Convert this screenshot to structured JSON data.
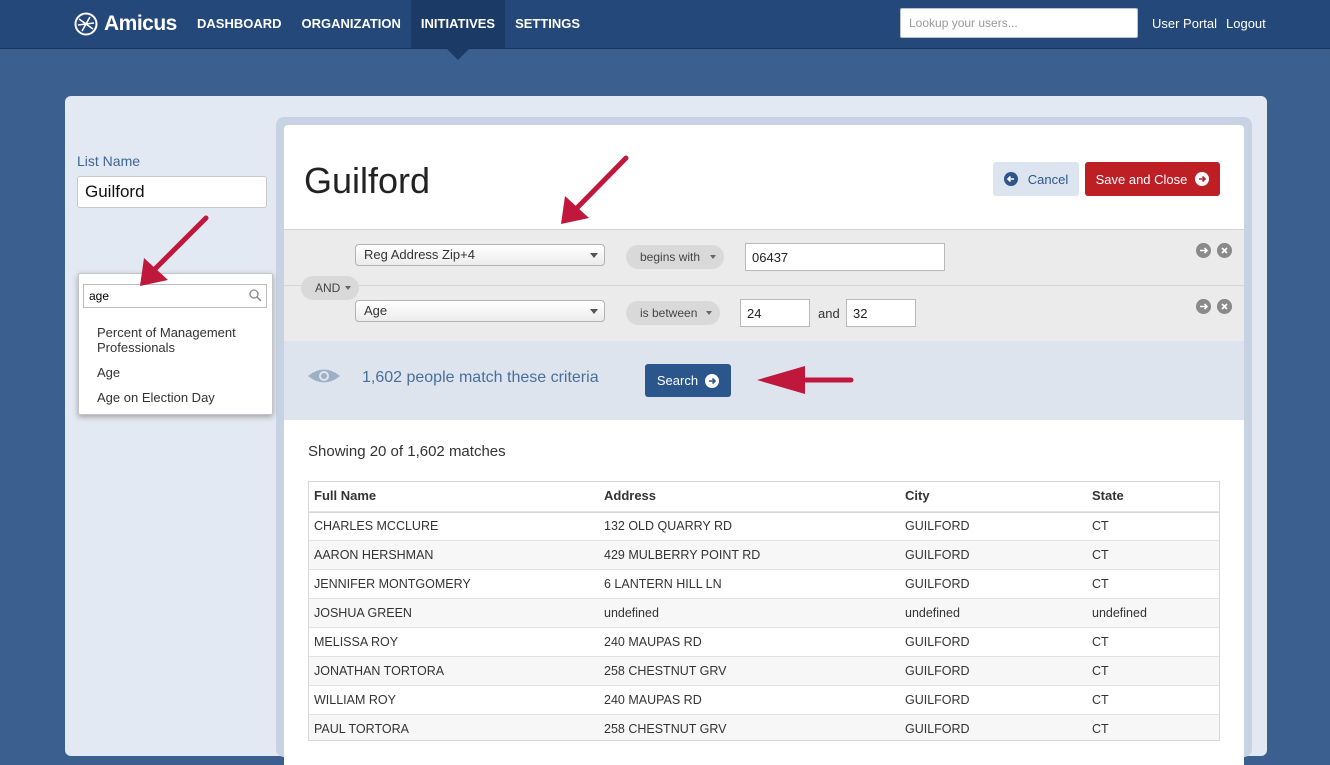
{
  "nav": {
    "brand": "Amicus",
    "links": [
      "DASHBOARD",
      "ORGANIZATION",
      "INITIATIVES",
      "SETTINGS"
    ],
    "active": "INITIATIVES",
    "lookup_placeholder": "Lookup your users...",
    "user_portal": "User Portal",
    "logout": "Logout"
  },
  "sidebar": {
    "list_name_label": "List Name",
    "list_name_value": "Guilford",
    "search_value": "age",
    "options": [
      "Percent of Management Professionals",
      "Age",
      "Age on Election Day"
    ]
  },
  "header": {
    "title": "Guilford",
    "cancel_label": "Cancel",
    "save_label": "Save and Close"
  },
  "criteria": {
    "conjunction": "AND",
    "rows": [
      {
        "field": "Reg Address Zip+4",
        "operator": "begins with",
        "value1": "06437"
      },
      {
        "field": "Age",
        "operator": "is between",
        "value1": "24",
        "and_word": "and",
        "value2": "32"
      }
    ]
  },
  "match": {
    "text": "1,602 people match these criteria",
    "search_label": "Search"
  },
  "results": {
    "showing": "Showing 20 of 1,602 matches",
    "columns": [
      "Full Name",
      "Address",
      "City",
      "State"
    ],
    "rows": [
      [
        "CHARLES MCCLURE",
        "132 OLD QUARRY RD",
        "GUILFORD",
        "CT"
      ],
      [
        "AARON HERSHMAN",
        "429 MULBERRY POINT RD",
        "GUILFORD",
        "CT"
      ],
      [
        "JENNIFER MONTGOMERY",
        "6 LANTERN HILL LN",
        "GUILFORD",
        "CT"
      ],
      [
        "JOSHUA GREEN",
        "undefined",
        "undefined",
        "undefined"
      ],
      [
        "MELISSA ROY",
        "240 MAUPAS RD",
        "GUILFORD",
        "CT"
      ],
      [
        "JONATHAN TORTORA",
        "258 CHESTNUT GRV",
        "GUILFORD",
        "CT"
      ],
      [
        "WILLIAM ROY",
        "240 MAUPAS RD",
        "GUILFORD",
        "CT"
      ],
      [
        "PAUL TORTORA",
        "258 CHESTNUT GRV",
        "GUILFORD",
        "CT"
      ]
    ]
  },
  "colors": {
    "nav_bg": "#24487a",
    "page_bg": "#3b5f8e",
    "save_red": "#bd1f25",
    "search_blue": "#2a568b",
    "annotation_arrow": "#c0183d"
  }
}
